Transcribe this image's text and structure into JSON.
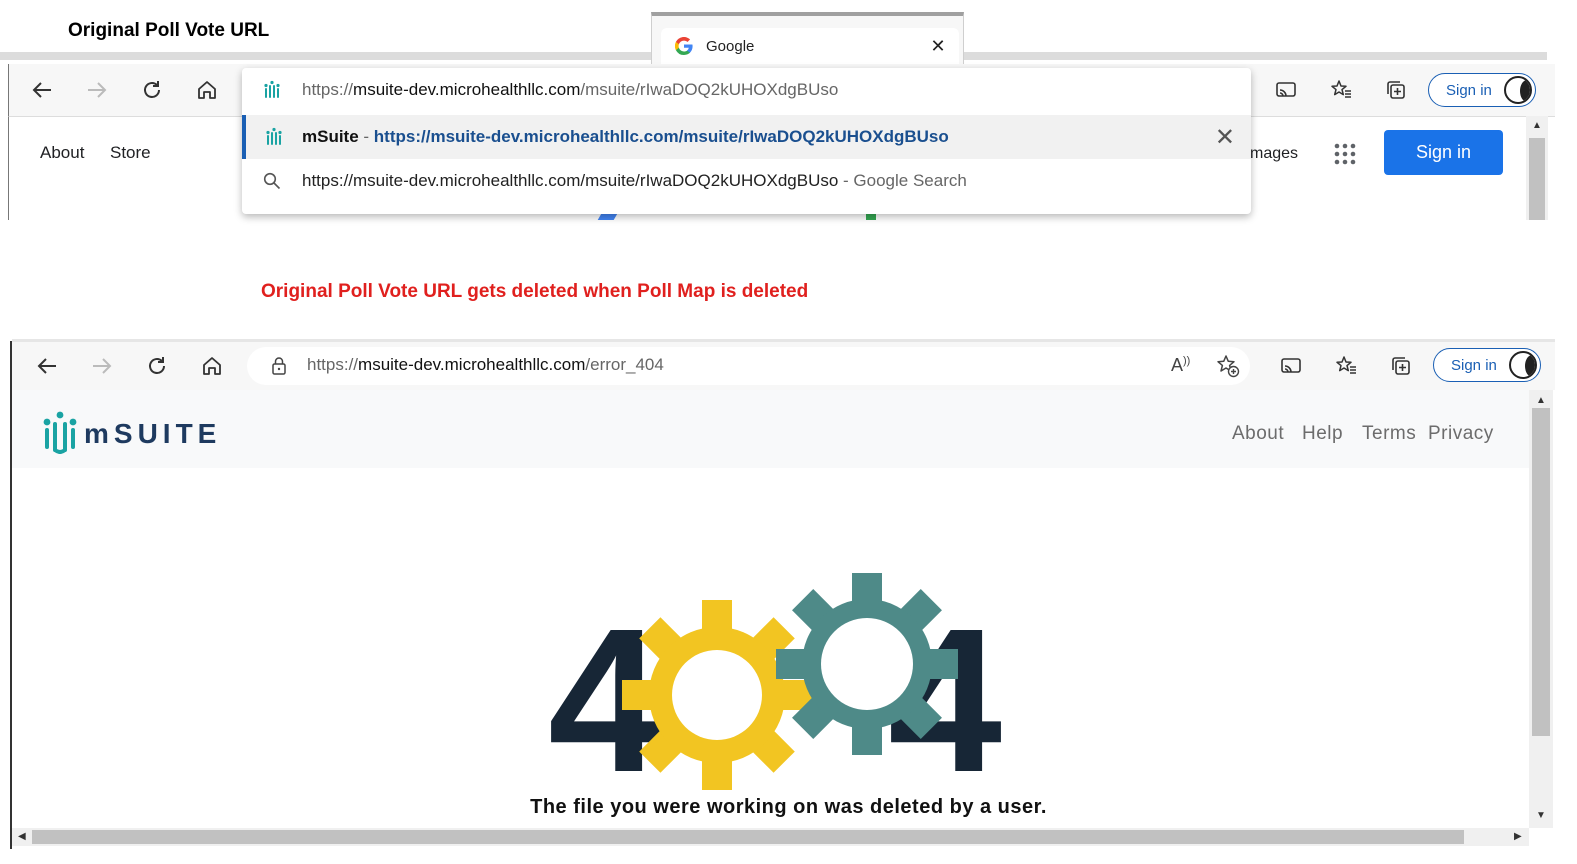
{
  "captions": {
    "top": "Original Poll Vote URL",
    "middle": "Original Poll Vote URL gets deleted when Poll Map is deleted"
  },
  "shot1": {
    "tab": {
      "title": "Google",
      "favicon": "google-g-icon"
    },
    "toolbar": {
      "sign_in": "Sign in"
    },
    "google_nav": {
      "about": "About",
      "store": "Store",
      "images": "mages",
      "sign_in": "Sign in"
    },
    "omnibox": {
      "input": {
        "domain_prefix": "https://",
        "domain": "msuite-dev.microhealthllc.com",
        "path": "/msuite/rIwaDOQ2kUHOXdgBUso"
      },
      "suggestions": [
        {
          "icon": "msuite-favicon",
          "title": "mSuite",
          "separator": " - ",
          "url": "https://msuite-dev.microhealthllc.com/msuite/rIwaDOQ2kUHOXdgBUso"
        },
        {
          "icon": "search-icon",
          "text": "https://msuite-dev.microhealthllc.com/msuite/rIwaDOQ2kUHOXdgBUso",
          "suffix": " - Google Search"
        }
      ]
    }
  },
  "shot2": {
    "address": {
      "prefix": "https://",
      "domain": "msuite-dev.microhealthllc.com",
      "path": "/error_404"
    },
    "toolbar": {
      "sign_in": "Sign in"
    },
    "site": {
      "logo_text": "mSUITE",
      "nav": [
        "About",
        "Help",
        "Terms",
        "Privacy"
      ]
    },
    "error": {
      "digit_left": "4",
      "digit_right": "4",
      "message": "The file you were working on was deleted by a user."
    }
  },
  "colors": {
    "accent_blue": "#1a73e8",
    "edge_blue": "#1a5fb4",
    "caption_red": "#e0201e",
    "gear_yellow": "#f2c522",
    "gear_teal": "#4e8a88",
    "digit_navy": "#172636",
    "msuite_teal": "#1aa3a3"
  }
}
